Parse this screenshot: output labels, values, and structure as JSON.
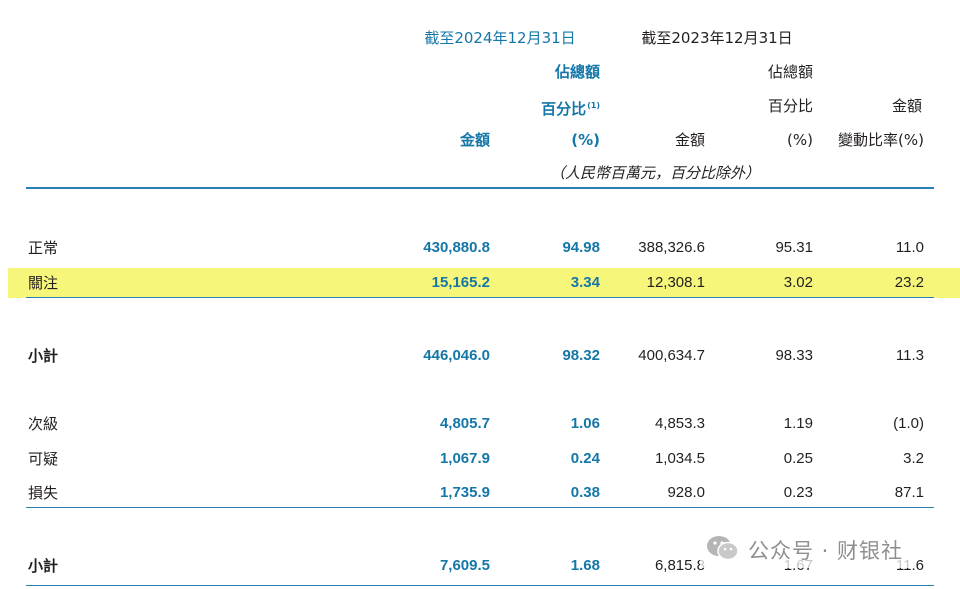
{
  "headers": {
    "period_2024": "截至2024年12月31日",
    "period_2023": "截至2023年12月31日",
    "share_2024_line1": "佔總額",
    "share_2024_line2": "百分比",
    "share_2024_sup": "(1)",
    "share_2024_unit": "(%)",
    "share_2023_line1": "佔總額",
    "share_2023_line2": "百分比",
    "share_2023_unit": "(%)",
    "amount_2024": "金額",
    "amount_2023": "金額",
    "change_line1": "金額",
    "change_line2": "變動比率(%)",
    "unit_note": "（人民幣百萬元，百分比除外）"
  },
  "rows": [
    {
      "label": "正常",
      "amount_2024": "430,880.8",
      "share_2024": "94.98",
      "amount_2023": "388,326.6",
      "share_2023": "95.31",
      "change": "11.0",
      "bold": false,
      "highlighted": false
    },
    {
      "label": "關注",
      "amount_2024": "15,165.2",
      "share_2024": "3.34",
      "amount_2023": "12,308.1",
      "share_2023": "3.02",
      "change": "23.2",
      "bold": false,
      "highlighted": true
    },
    {
      "label": "小計",
      "amount_2024": "446,046.0",
      "share_2024": "98.32",
      "amount_2023": "400,634.7",
      "share_2023": "98.33",
      "change": "11.3",
      "bold": true,
      "highlighted": false
    },
    {
      "label": "次級",
      "amount_2024": "4,805.7",
      "share_2024": "1.06",
      "amount_2023": "4,853.3",
      "share_2023": "1.19",
      "change": "(1.0)",
      "bold": false,
      "highlighted": false
    },
    {
      "label": "可疑",
      "amount_2024": "1,067.9",
      "share_2024": "0.24",
      "amount_2023": "1,034.5",
      "share_2023": "0.25",
      "change": "3.2",
      "bold": false,
      "highlighted": false
    },
    {
      "label": "損失",
      "amount_2024": "1,735.9",
      "share_2024": "0.38",
      "amount_2023": "928.0",
      "share_2023": "0.23",
      "change": "87.1",
      "bold": false,
      "highlighted": false
    },
    {
      "label": "小計",
      "amount_2024": "7,609.5",
      "share_2024": "1.68",
      "amount_2023": "6,815.8",
      "share_2023": "1.67",
      "change": "11.6",
      "bold": true,
      "highlighted": false
    }
  ],
  "watermark": {
    "text": "公众号 · 财银社",
    "icon": "wechat-icon"
  },
  "colors": {
    "accent_blue": "#1577a8",
    "text": "#231f20",
    "highlight": "#f6f67a",
    "rule": "#2b7fb0"
  }
}
